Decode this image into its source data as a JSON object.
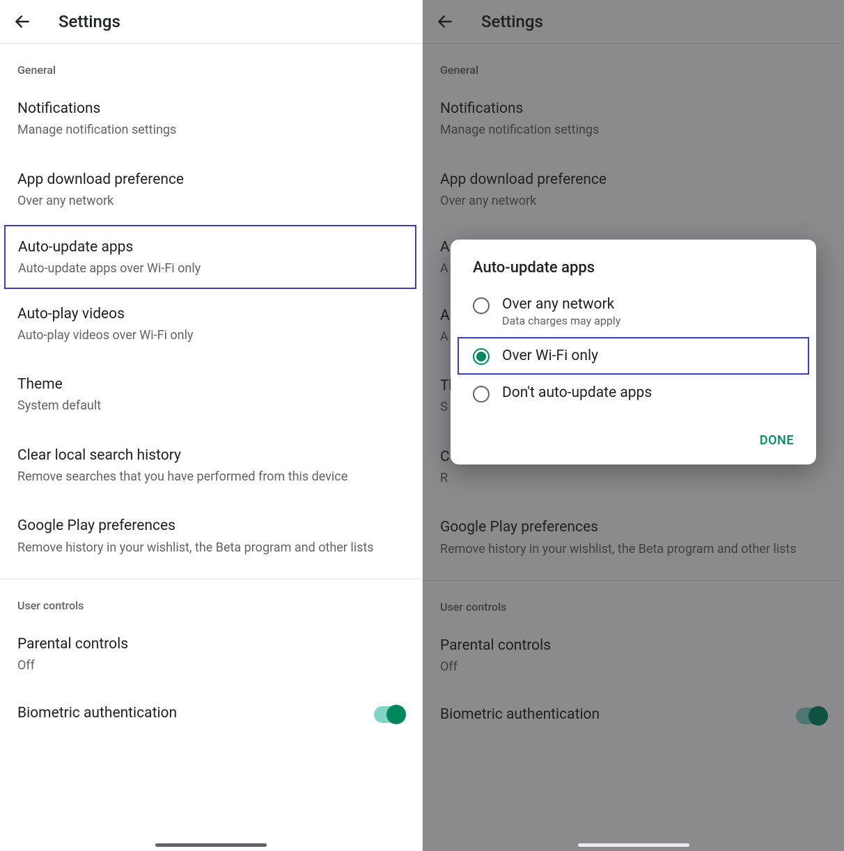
{
  "header": {
    "title": "Settings"
  },
  "section1": "General",
  "items": {
    "notifications": {
      "title": "Notifications",
      "sub": "Manage notification settings"
    },
    "download": {
      "title": "App download preference",
      "sub": "Over any network"
    },
    "autoupdate": {
      "title": "Auto-update apps",
      "sub": "Auto-update apps over Wi-Fi only"
    },
    "autoplay": {
      "title": "Auto-play videos",
      "sub": "Auto-play videos over Wi-Fi only"
    },
    "theme": {
      "title": "Theme",
      "sub": "System default"
    },
    "clearsearch": {
      "title": "Clear local search history",
      "sub": "Remove searches that you have performed from this device"
    },
    "gplay": {
      "title": "Google Play preferences",
      "sub": "Remove history in your wishlist, the Beta program and other lists"
    }
  },
  "section2": "User controls",
  "items2": {
    "parental": {
      "title": "Parental controls",
      "sub": "Off"
    },
    "biometric": {
      "title": "Biometric authentication"
    }
  },
  "dialog": {
    "title": "Auto-update apps",
    "opt1": {
      "label": "Over any network",
      "sub": "Data charges may apply"
    },
    "opt2": {
      "label": "Over Wi-Fi only"
    },
    "opt3": {
      "label": "Don't auto-update apps"
    },
    "done": "DONE"
  },
  "right_autoupdate_sub_truncated": "A",
  "right_autoplay_sub_truncated": "A",
  "right_theme_sub_truncated": "S",
  "right_clear_title_truncated": "C",
  "right_clear_sub_truncated": "R"
}
